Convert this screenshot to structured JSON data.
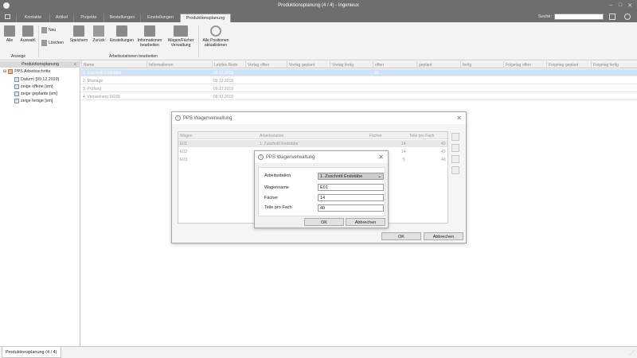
{
  "window": {
    "title": "Produktionsplanung (4 / 4) - Ingenieux"
  },
  "menu": {
    "tabs": [
      {
        "label": "Kontakte"
      },
      {
        "label": "Artikel"
      },
      {
        "label": "Projekte"
      },
      {
        "label": "Bestellungen"
      },
      {
        "label": "Einstellungen"
      },
      {
        "label": "Produktionsplanung"
      }
    ]
  },
  "search": {
    "label": "Suche:",
    "value": ""
  },
  "ribbon": {
    "buttons": {
      "alle": "Alle",
      "auswahl": "Auswahl",
      "neu": "Neu",
      "loeschen": "Löschen",
      "speichern": "Speichern",
      "zurueck": "Zurück",
      "einstellungen": "Einstellungen",
      "informationen": "Informationen bearbeiten",
      "wagen": "Wagen/Fächer Verwaltung",
      "aktualisieren": "Alle Positionen aktualisieren"
    },
    "groups": {
      "anzeige": "Anzeige",
      "arbeitsstationen": "Arbeitsstationen bearbeiten"
    }
  },
  "left_panel": {
    "title": "Produktionsplanung",
    "tree": [
      {
        "label": "PPS Arbeitsschritte"
      },
      {
        "label": "Datum: [09.12.2019]"
      },
      {
        "label": "zeige offene [sm]"
      },
      {
        "label": "zeige geplante [sm]"
      },
      {
        "label": "zeige fertige [sm]"
      }
    ]
  },
  "grid": {
    "columns": [
      "Name",
      "Informationen",
      "Letztes Redo",
      "Vortag offen",
      "Vortag geplant",
      "Vortag fertig",
      "offen",
      "geplant",
      "fertig",
      "Folgetag offen",
      "Folgetag geplant",
      "Folgetag fertig"
    ],
    "rows": [
      {
        "name": "1. Zuschnitt Endstäbe",
        "info": "",
        "date": "09.12.2019",
        "offen": "30"
      },
      {
        "name": "2. Montage",
        "info": "",
        "date": "09.12.2019",
        "offen": ""
      },
      {
        "name": "3. Prüfung",
        "info": "",
        "date": "09.12.2019",
        "offen": ""
      },
      {
        "name": "4. Verpackung SGS5",
        "info": "",
        "date": "09.12.2019",
        "offen": ""
      }
    ]
  },
  "outer_dialog": {
    "title": "PPS Wagenverwaltung",
    "columns": [
      "Wagen",
      "Arbeitsstation",
      "Fächer",
      "Teile pro Fach"
    ],
    "rows": [
      {
        "wagen": "E01",
        "station": "1. Zuschnitt Endstäbe",
        "faecher": "14",
        "teile": "40"
      },
      {
        "wagen": "E02",
        "station": "",
        "faecher": "14",
        "teile": "40"
      },
      {
        "wagen": "E03",
        "station": "",
        "faecher": "5",
        "teile": "40"
      }
    ],
    "ok": "OK",
    "cancel": "Abbrechen"
  },
  "inner_dialog": {
    "title": "PPS Wagenverwaltung",
    "fields": {
      "station_label": "Arbeitsstation",
      "station_value": "1. Zuschnitt Endstäbe",
      "wagen_label": "Wagenname",
      "wagen_value": "E01",
      "faecher_label": "Fächer",
      "faecher_value": "14",
      "teile_label": "Teile pro Fach",
      "teile_value": "40"
    },
    "ok": "OK",
    "cancel": "Abbrechen"
  },
  "status": {
    "tab": "Produktionsplanung (4 / 4)"
  },
  "colors": {
    "titlebar": "#6e6e6e",
    "selection": "#cfe3f7"
  }
}
